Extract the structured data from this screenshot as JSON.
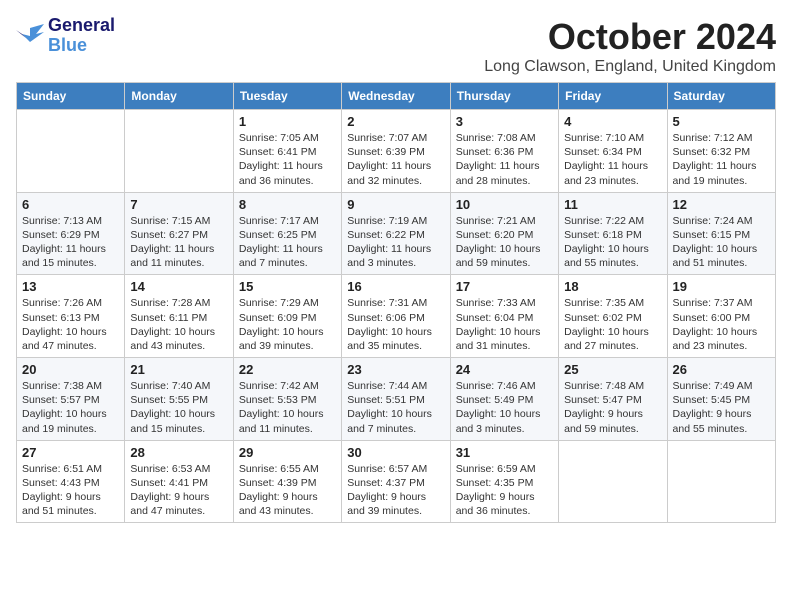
{
  "logo": {
    "line1": "General",
    "line2": "Blue"
  },
  "header": {
    "month": "October 2024",
    "location": "Long Clawson, England, United Kingdom"
  },
  "weekdays": [
    "Sunday",
    "Monday",
    "Tuesday",
    "Wednesday",
    "Thursday",
    "Friday",
    "Saturday"
  ],
  "weeks": [
    [
      {
        "day": "",
        "detail": ""
      },
      {
        "day": "",
        "detail": ""
      },
      {
        "day": "1",
        "detail": "Sunrise: 7:05 AM\nSunset: 6:41 PM\nDaylight: 11 hours and 36 minutes."
      },
      {
        "day": "2",
        "detail": "Sunrise: 7:07 AM\nSunset: 6:39 PM\nDaylight: 11 hours and 32 minutes."
      },
      {
        "day": "3",
        "detail": "Sunrise: 7:08 AM\nSunset: 6:36 PM\nDaylight: 11 hours and 28 minutes."
      },
      {
        "day": "4",
        "detail": "Sunrise: 7:10 AM\nSunset: 6:34 PM\nDaylight: 11 hours and 23 minutes."
      },
      {
        "day": "5",
        "detail": "Sunrise: 7:12 AM\nSunset: 6:32 PM\nDaylight: 11 hours and 19 minutes."
      }
    ],
    [
      {
        "day": "6",
        "detail": "Sunrise: 7:13 AM\nSunset: 6:29 PM\nDaylight: 11 hours and 15 minutes."
      },
      {
        "day": "7",
        "detail": "Sunrise: 7:15 AM\nSunset: 6:27 PM\nDaylight: 11 hours and 11 minutes."
      },
      {
        "day": "8",
        "detail": "Sunrise: 7:17 AM\nSunset: 6:25 PM\nDaylight: 11 hours and 7 minutes."
      },
      {
        "day": "9",
        "detail": "Sunrise: 7:19 AM\nSunset: 6:22 PM\nDaylight: 11 hours and 3 minutes."
      },
      {
        "day": "10",
        "detail": "Sunrise: 7:21 AM\nSunset: 6:20 PM\nDaylight: 10 hours and 59 minutes."
      },
      {
        "day": "11",
        "detail": "Sunrise: 7:22 AM\nSunset: 6:18 PM\nDaylight: 10 hours and 55 minutes."
      },
      {
        "day": "12",
        "detail": "Sunrise: 7:24 AM\nSunset: 6:15 PM\nDaylight: 10 hours and 51 minutes."
      }
    ],
    [
      {
        "day": "13",
        "detail": "Sunrise: 7:26 AM\nSunset: 6:13 PM\nDaylight: 10 hours and 47 minutes."
      },
      {
        "day": "14",
        "detail": "Sunrise: 7:28 AM\nSunset: 6:11 PM\nDaylight: 10 hours and 43 minutes."
      },
      {
        "day": "15",
        "detail": "Sunrise: 7:29 AM\nSunset: 6:09 PM\nDaylight: 10 hours and 39 minutes."
      },
      {
        "day": "16",
        "detail": "Sunrise: 7:31 AM\nSunset: 6:06 PM\nDaylight: 10 hours and 35 minutes."
      },
      {
        "day": "17",
        "detail": "Sunrise: 7:33 AM\nSunset: 6:04 PM\nDaylight: 10 hours and 31 minutes."
      },
      {
        "day": "18",
        "detail": "Sunrise: 7:35 AM\nSunset: 6:02 PM\nDaylight: 10 hours and 27 minutes."
      },
      {
        "day": "19",
        "detail": "Sunrise: 7:37 AM\nSunset: 6:00 PM\nDaylight: 10 hours and 23 minutes."
      }
    ],
    [
      {
        "day": "20",
        "detail": "Sunrise: 7:38 AM\nSunset: 5:57 PM\nDaylight: 10 hours and 19 minutes."
      },
      {
        "day": "21",
        "detail": "Sunrise: 7:40 AM\nSunset: 5:55 PM\nDaylight: 10 hours and 15 minutes."
      },
      {
        "day": "22",
        "detail": "Sunrise: 7:42 AM\nSunset: 5:53 PM\nDaylight: 10 hours and 11 minutes."
      },
      {
        "day": "23",
        "detail": "Sunrise: 7:44 AM\nSunset: 5:51 PM\nDaylight: 10 hours and 7 minutes."
      },
      {
        "day": "24",
        "detail": "Sunrise: 7:46 AM\nSunset: 5:49 PM\nDaylight: 10 hours and 3 minutes."
      },
      {
        "day": "25",
        "detail": "Sunrise: 7:48 AM\nSunset: 5:47 PM\nDaylight: 9 hours and 59 minutes."
      },
      {
        "day": "26",
        "detail": "Sunrise: 7:49 AM\nSunset: 5:45 PM\nDaylight: 9 hours and 55 minutes."
      }
    ],
    [
      {
        "day": "27",
        "detail": "Sunrise: 6:51 AM\nSunset: 4:43 PM\nDaylight: 9 hours and 51 minutes."
      },
      {
        "day": "28",
        "detail": "Sunrise: 6:53 AM\nSunset: 4:41 PM\nDaylight: 9 hours and 47 minutes."
      },
      {
        "day": "29",
        "detail": "Sunrise: 6:55 AM\nSunset: 4:39 PM\nDaylight: 9 hours and 43 minutes."
      },
      {
        "day": "30",
        "detail": "Sunrise: 6:57 AM\nSunset: 4:37 PM\nDaylight: 9 hours and 39 minutes."
      },
      {
        "day": "31",
        "detail": "Sunrise: 6:59 AM\nSunset: 4:35 PM\nDaylight: 9 hours and 36 minutes."
      },
      {
        "day": "",
        "detail": ""
      },
      {
        "day": "",
        "detail": ""
      }
    ]
  ]
}
